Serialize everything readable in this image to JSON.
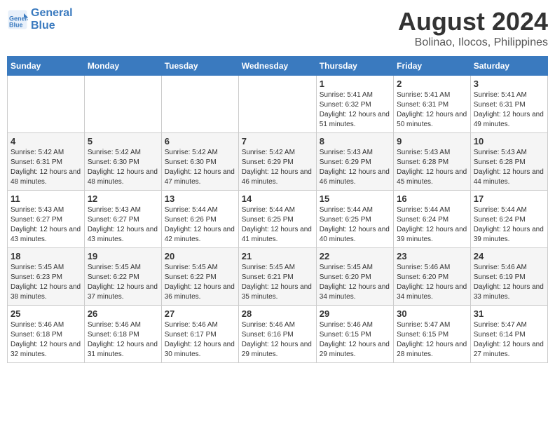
{
  "header": {
    "logo_line1": "General",
    "logo_line2": "Blue",
    "main_title": "August 2024",
    "subtitle": "Bolinao, Ilocos, Philippines"
  },
  "days_of_week": [
    "Sunday",
    "Monday",
    "Tuesday",
    "Wednesday",
    "Thursday",
    "Friday",
    "Saturday"
  ],
  "weeks": [
    [
      {
        "day": "",
        "sunrise": "",
        "sunset": "",
        "daylight": ""
      },
      {
        "day": "",
        "sunrise": "",
        "sunset": "",
        "daylight": ""
      },
      {
        "day": "",
        "sunrise": "",
        "sunset": "",
        "daylight": ""
      },
      {
        "day": "",
        "sunrise": "",
        "sunset": "",
        "daylight": ""
      },
      {
        "day": "1",
        "sunrise": "Sunrise: 5:41 AM",
        "sunset": "Sunset: 6:32 PM",
        "daylight": "Daylight: 12 hours and 51 minutes."
      },
      {
        "day": "2",
        "sunrise": "Sunrise: 5:41 AM",
        "sunset": "Sunset: 6:31 PM",
        "daylight": "Daylight: 12 hours and 50 minutes."
      },
      {
        "day": "3",
        "sunrise": "Sunrise: 5:41 AM",
        "sunset": "Sunset: 6:31 PM",
        "daylight": "Daylight: 12 hours and 49 minutes."
      }
    ],
    [
      {
        "day": "4",
        "sunrise": "Sunrise: 5:42 AM",
        "sunset": "Sunset: 6:31 PM",
        "daylight": "Daylight: 12 hours and 48 minutes."
      },
      {
        "day": "5",
        "sunrise": "Sunrise: 5:42 AM",
        "sunset": "Sunset: 6:30 PM",
        "daylight": "Daylight: 12 hours and 48 minutes."
      },
      {
        "day": "6",
        "sunrise": "Sunrise: 5:42 AM",
        "sunset": "Sunset: 6:30 PM",
        "daylight": "Daylight: 12 hours and 47 minutes."
      },
      {
        "day": "7",
        "sunrise": "Sunrise: 5:42 AM",
        "sunset": "Sunset: 6:29 PM",
        "daylight": "Daylight: 12 hours and 46 minutes."
      },
      {
        "day": "8",
        "sunrise": "Sunrise: 5:43 AM",
        "sunset": "Sunset: 6:29 PM",
        "daylight": "Daylight: 12 hours and 46 minutes."
      },
      {
        "day": "9",
        "sunrise": "Sunrise: 5:43 AM",
        "sunset": "Sunset: 6:28 PM",
        "daylight": "Daylight: 12 hours and 45 minutes."
      },
      {
        "day": "10",
        "sunrise": "Sunrise: 5:43 AM",
        "sunset": "Sunset: 6:28 PM",
        "daylight": "Daylight: 12 hours and 44 minutes."
      }
    ],
    [
      {
        "day": "11",
        "sunrise": "Sunrise: 5:43 AM",
        "sunset": "Sunset: 6:27 PM",
        "daylight": "Daylight: 12 hours and 43 minutes."
      },
      {
        "day": "12",
        "sunrise": "Sunrise: 5:43 AM",
        "sunset": "Sunset: 6:27 PM",
        "daylight": "Daylight: 12 hours and 43 minutes."
      },
      {
        "day": "13",
        "sunrise": "Sunrise: 5:44 AM",
        "sunset": "Sunset: 6:26 PM",
        "daylight": "Daylight: 12 hours and 42 minutes."
      },
      {
        "day": "14",
        "sunrise": "Sunrise: 5:44 AM",
        "sunset": "Sunset: 6:25 PM",
        "daylight": "Daylight: 12 hours and 41 minutes."
      },
      {
        "day": "15",
        "sunrise": "Sunrise: 5:44 AM",
        "sunset": "Sunset: 6:25 PM",
        "daylight": "Daylight: 12 hours and 40 minutes."
      },
      {
        "day": "16",
        "sunrise": "Sunrise: 5:44 AM",
        "sunset": "Sunset: 6:24 PM",
        "daylight": "Daylight: 12 hours and 39 minutes."
      },
      {
        "day": "17",
        "sunrise": "Sunrise: 5:44 AM",
        "sunset": "Sunset: 6:24 PM",
        "daylight": "Daylight: 12 hours and 39 minutes."
      }
    ],
    [
      {
        "day": "18",
        "sunrise": "Sunrise: 5:45 AM",
        "sunset": "Sunset: 6:23 PM",
        "daylight": "Daylight: 12 hours and 38 minutes."
      },
      {
        "day": "19",
        "sunrise": "Sunrise: 5:45 AM",
        "sunset": "Sunset: 6:22 PM",
        "daylight": "Daylight: 12 hours and 37 minutes."
      },
      {
        "day": "20",
        "sunrise": "Sunrise: 5:45 AM",
        "sunset": "Sunset: 6:22 PM",
        "daylight": "Daylight: 12 hours and 36 minutes."
      },
      {
        "day": "21",
        "sunrise": "Sunrise: 5:45 AM",
        "sunset": "Sunset: 6:21 PM",
        "daylight": "Daylight: 12 hours and 35 minutes."
      },
      {
        "day": "22",
        "sunrise": "Sunrise: 5:45 AM",
        "sunset": "Sunset: 6:20 PM",
        "daylight": "Daylight: 12 hours and 34 minutes."
      },
      {
        "day": "23",
        "sunrise": "Sunrise: 5:46 AM",
        "sunset": "Sunset: 6:20 PM",
        "daylight": "Daylight: 12 hours and 34 minutes."
      },
      {
        "day": "24",
        "sunrise": "Sunrise: 5:46 AM",
        "sunset": "Sunset: 6:19 PM",
        "daylight": "Daylight: 12 hours and 33 minutes."
      }
    ],
    [
      {
        "day": "25",
        "sunrise": "Sunrise: 5:46 AM",
        "sunset": "Sunset: 6:18 PM",
        "daylight": "Daylight: 12 hours and 32 minutes."
      },
      {
        "day": "26",
        "sunrise": "Sunrise: 5:46 AM",
        "sunset": "Sunset: 6:18 PM",
        "daylight": "Daylight: 12 hours and 31 minutes."
      },
      {
        "day": "27",
        "sunrise": "Sunrise: 5:46 AM",
        "sunset": "Sunset: 6:17 PM",
        "daylight": "Daylight: 12 hours and 30 minutes."
      },
      {
        "day": "28",
        "sunrise": "Sunrise: 5:46 AM",
        "sunset": "Sunset: 6:16 PM",
        "daylight": "Daylight: 12 hours and 29 minutes."
      },
      {
        "day": "29",
        "sunrise": "Sunrise: 5:46 AM",
        "sunset": "Sunset: 6:15 PM",
        "daylight": "Daylight: 12 hours and 29 minutes."
      },
      {
        "day": "30",
        "sunrise": "Sunrise: 5:47 AM",
        "sunset": "Sunset: 6:15 PM",
        "daylight": "Daylight: 12 hours and 28 minutes."
      },
      {
        "day": "31",
        "sunrise": "Sunrise: 5:47 AM",
        "sunset": "Sunset: 6:14 PM",
        "daylight": "Daylight: 12 hours and 27 minutes."
      }
    ]
  ]
}
